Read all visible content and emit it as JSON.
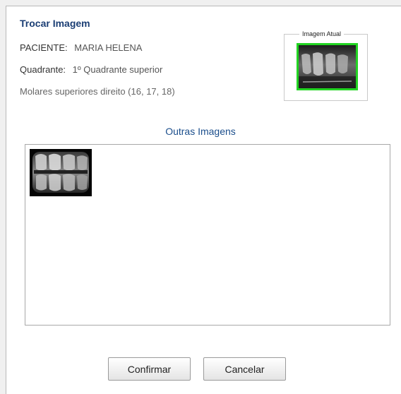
{
  "dialog": {
    "title": "Trocar Imagem"
  },
  "patient": {
    "label": "PACIENTE:",
    "value": "MARIA HELENA"
  },
  "quadrant": {
    "label": "Quadrante:",
    "value": "1º Quadrante superior"
  },
  "teeth_description": "Molares superiores direito (16, 17, 18)",
  "current_image": {
    "legend": "Imagem Atual",
    "highlight_color": "#22d422"
  },
  "other_images": {
    "title": "Outras Imagens",
    "thumbnails": [
      {
        "kind": "dental-xray"
      }
    ]
  },
  "buttons": {
    "confirm": "Confirmar",
    "cancel": "Cancelar"
  }
}
